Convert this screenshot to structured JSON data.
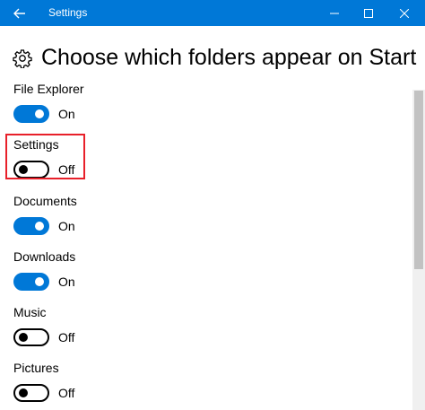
{
  "window": {
    "title": "Settings",
    "title_bar_color": "#0078d7",
    "back_icon": "back-arrow-icon",
    "minimize_icon": "minimize-icon",
    "maximize_icon": "maximize-icon",
    "close_icon": "close-icon"
  },
  "page": {
    "title": "Choose which folders appear on Start",
    "icon": "gear-icon"
  },
  "settings": [
    {
      "label": "File Explorer",
      "state": "On",
      "on": true
    },
    {
      "label": "Settings",
      "state": "Off",
      "on": false,
      "highlighted": true
    },
    {
      "label": "Documents",
      "state": "On",
      "on": true
    },
    {
      "label": "Downloads",
      "state": "On",
      "on": true
    },
    {
      "label": "Music",
      "state": "Off",
      "on": false
    },
    {
      "label": "Pictures",
      "state": "Off",
      "on": false
    }
  ],
  "colors": {
    "accent": "#0078d7",
    "highlight_box": "#e8202a"
  }
}
